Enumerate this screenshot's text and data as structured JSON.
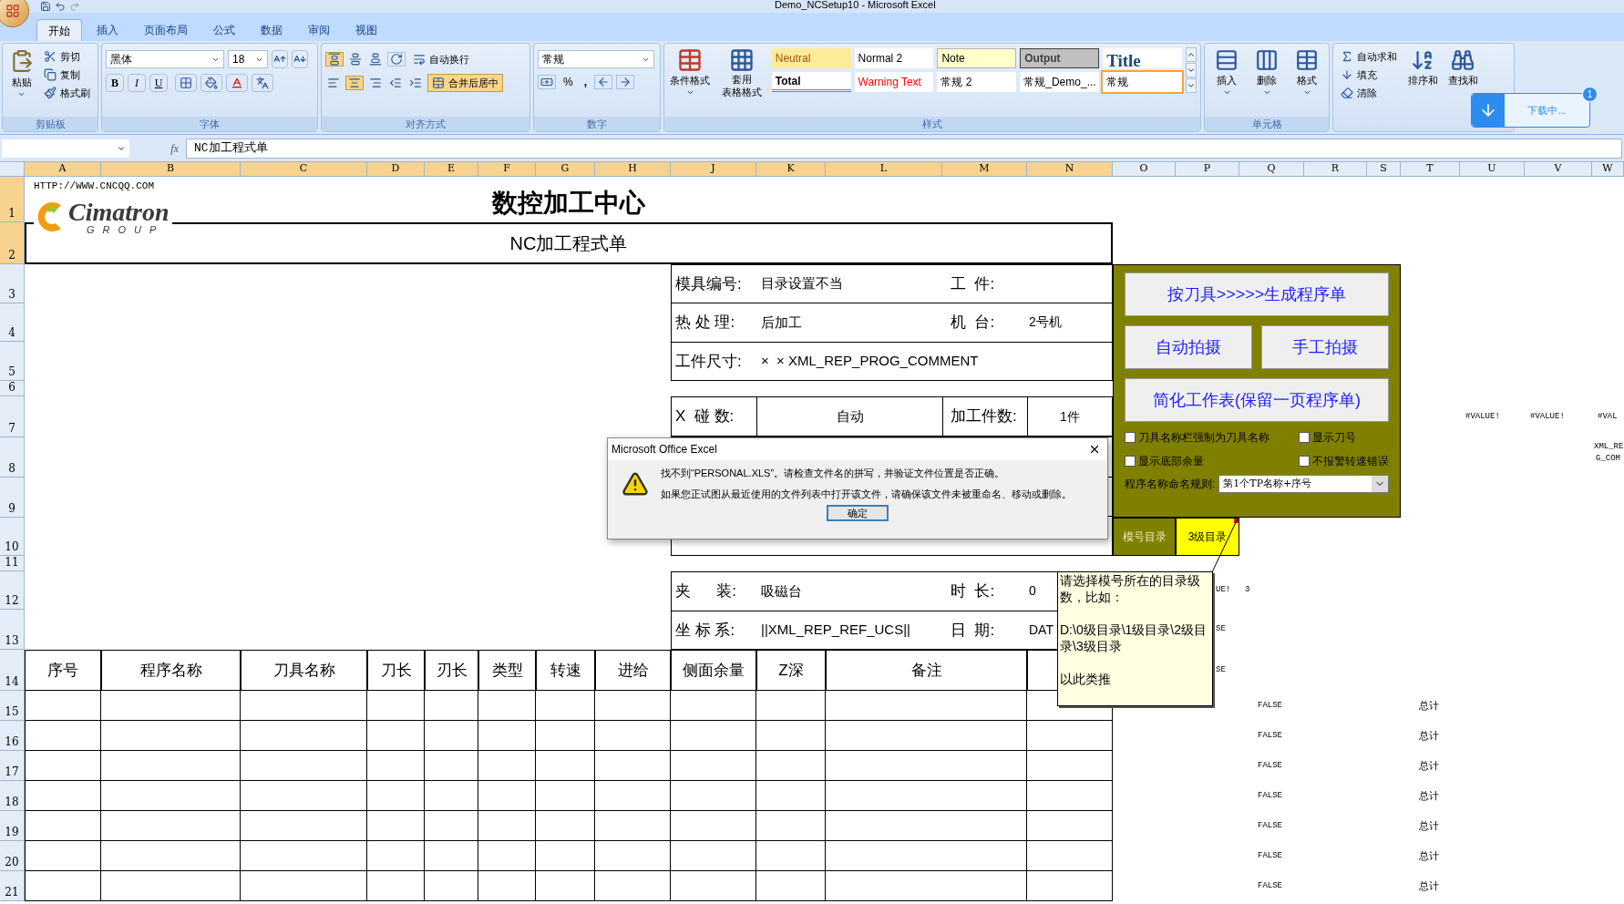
{
  "window": {
    "title": "Demo_NCSetup10 - Microsoft Excel"
  },
  "tabs": [
    {
      "label": "开始",
      "selected": true
    },
    {
      "label": "插入",
      "selected": false
    },
    {
      "label": "页面布局",
      "selected": false
    },
    {
      "label": "公式",
      "selected": false
    },
    {
      "label": "数据",
      "selected": false
    },
    {
      "label": "审阅",
      "selected": false
    },
    {
      "label": "视图",
      "selected": false
    }
  ],
  "ribbon": {
    "clipboard": {
      "label": "剪贴板",
      "paste": "粘贴",
      "items": [
        "剪切",
        "复制",
        "格式刷"
      ]
    },
    "font": {
      "label": "字体",
      "font_name": "黑体",
      "font_size": "18",
      "format_buttons": [
        "B",
        "I",
        "U"
      ]
    },
    "alignment": {
      "label": "对齐方式",
      "wrap": "自动换行",
      "merge": "合并后居中",
      "merge_on": true
    },
    "number": {
      "label": "数字",
      "format": "常规",
      "percent": "%",
      "comma": ","
    },
    "styles": {
      "label": "样式",
      "conditional": "条件格式",
      "table_format": [
        "套用",
        "表格格式"
      ],
      "gallery": [
        {
          "text": "Neutral",
          "kind": "neutral",
          "selected": false
        },
        {
          "text": "Normal 2",
          "kind": "plain",
          "selected": false
        },
        {
          "text": "Note",
          "kind": "note",
          "selected": false
        },
        {
          "text": "Output",
          "kind": "output",
          "selected": false
        },
        {
          "text": "Title",
          "kind": "title",
          "selected": false
        },
        {
          "text": "Total",
          "kind": "total",
          "selected": false
        },
        {
          "text": "Warning Text",
          "kind": "warning",
          "selected": false
        },
        {
          "text": "常规 2",
          "kind": "plain",
          "selected": false
        },
        {
          "text": "常规_Demo_...",
          "kind": "plain",
          "selected": false
        },
        {
          "text": "常规",
          "kind": "plain",
          "selected": true
        }
      ]
    },
    "cells": {
      "label": "单元格",
      "items": [
        "插入",
        "删除",
        "格式"
      ]
    },
    "editing": {
      "items": [
        "自动求和",
        "填充",
        "清除"
      ],
      "large": [
        "排序和",
        "查找和"
      ]
    }
  },
  "download": {
    "label": "下载中...",
    "count": "1"
  },
  "formula_bar": {
    "fx": "fx",
    "formula": "NC加工程式单"
  },
  "sheet": {
    "columns": [
      {
        "label": "A",
        "selected": true
      },
      {
        "label": "B",
        "selected": true
      },
      {
        "label": "C",
        "selected": true
      },
      {
        "label": "D",
        "selected": true
      },
      {
        "label": "E",
        "selected": true
      },
      {
        "label": "F",
        "selected": true
      },
      {
        "label": "G",
        "selected": true
      },
      {
        "label": "H",
        "selected": true
      },
      {
        "label": "J",
        "selected": true
      },
      {
        "label": "K",
        "selected": true
      },
      {
        "label": "L",
        "selected": true
      },
      {
        "label": "M",
        "selected": true
      },
      {
        "label": "N",
        "selected": true
      },
      {
        "label": "O",
        "selected": false
      },
      {
        "label": "P",
        "selected": false
      },
      {
        "label": "Q",
        "selected": false
      },
      {
        "label": "R",
        "selected": false
      },
      {
        "label": "S",
        "selected": false
      },
      {
        "label": "T",
        "selected": false
      },
      {
        "label": "U",
        "selected": false
      },
      {
        "label": "V",
        "selected": false
      },
      {
        "label": "W",
        "selected": false
      }
    ],
    "rows": [
      {
        "label": "1",
        "selected": true
      },
      {
        "label": "2",
        "selected": true
      },
      {
        "label": "3",
        "selected": false
      },
      {
        "label": "4",
        "selected": false
      },
      {
        "label": "5",
        "selected": false
      },
      {
        "label": "6",
        "selected": false
      },
      {
        "label": "7",
        "selected": false
      },
      {
        "label": "8",
        "selected": false
      },
      {
        "label": "9",
        "selected": false
      },
      {
        "label": "10",
        "selected": false
      },
      {
        "label": "11",
        "selected": false
      },
      {
        "label": "12",
        "selected": false
      },
      {
        "label": "13",
        "selected": false
      },
      {
        "label": "14",
        "selected": false
      },
      {
        "label": "15",
        "selected": false
      },
      {
        "label": "16",
        "selected": false
      },
      {
        "label": "17",
        "selected": false
      },
      {
        "label": "18",
        "selected": false
      },
      {
        "label": "19",
        "selected": false
      },
      {
        "label": "20",
        "selected": false
      },
      {
        "label": "21",
        "selected": false
      }
    ],
    "url": "HTTP://WWW.CNCQQ.COM",
    "logo": {
      "name": "Cimatron",
      "tagline": "GROUP"
    },
    "title": "数控加工中心",
    "subtitle": "NC加工程式单",
    "info_top": [
      {
        "label": "模具编号:",
        "value": "目录设置不当",
        "label2": "工  件:"
      },
      {
        "label": "热 处 理:",
        "value": "后加工",
        "label2": "机  台:",
        "value2": "2号机"
      },
      {
        "label": "工件尺寸:",
        "value": "×  × XML_REP_PROG_COMMENT"
      }
    ],
    "info_mid": {
      "label": "X  碰 数:",
      "value": "自动",
      "label2": "加工件数:",
      "value2": "1件"
    },
    "info_bottom": [
      {
        "label": "夹      装:",
        "value": "吸磁台",
        "label2": "时  长:",
        "value2": "0"
      },
      {
        "label": "坐 标 系:",
        "value": "||XML_REP_REF_UCS||",
        "label2": "日  期:",
        "value2": "DAT"
      }
    ],
    "table_headers": [
      "序号",
      "程序名称",
      "刀具名称",
      "刀长",
      "刃长",
      "类型",
      "转速",
      "进给",
      "侧面余量",
      "Z深",
      "备注"
    ],
    "dir_cells": [
      "模号目录",
      "3级目录"
    ],
    "side_values": [
      "#VALUE!",
      "#VALUE!",
      "#VAL",
      "XML_RE",
      "G_COM",
      "UE!",
      "3",
      "SE",
      "SE"
    ],
    "status_rows": [
      {
        "flag": "FALSE",
        "total": "总计"
      },
      {
        "flag": "FALSE",
        "total": "总计"
      },
      {
        "flag": "FALSE",
        "total": "总计"
      },
      {
        "flag": "FALSE",
        "total": "总计"
      },
      {
        "flag": "FALSE",
        "total": "总计"
      },
      {
        "flag": "FALSE",
        "total": "总计"
      },
      {
        "flag": "FALSE",
        "total": "总计"
      }
    ]
  },
  "panel": {
    "buttons": [
      "按刀具>>>>>生成程序单",
      "自动拍摄",
      "手工拍摄",
      "简化工作表(保留一页程序单)"
    ],
    "checkboxes": [
      {
        "label": "刀具名称栏强制为刀具名称",
        "checked": false
      },
      {
        "label": "显示刀号",
        "checked": false
      },
      {
        "label": "显示底部余量",
        "checked": false
      },
      {
        "label": "不报警转速错误",
        "checked": false
      }
    ],
    "rule_label": "程序名称命名规则:",
    "rule_value": "第1个TP名称+序号"
  },
  "comment": {
    "lines": [
      "请选择模号所在的目录级数，比如：",
      "D:\\0级目录\\1级目录\\2级目录\\3级目录",
      "以此类推"
    ]
  },
  "dialog": {
    "title": "Microsoft Office Excel",
    "lines": [
      "找不到“PERSONAL.XLS”。请检查文件名的拼写，并验证文件位置是否正确。",
      "如果您正试图从最近使用的文件列表中打开该文件，请确保该文件未被重命名、移动或删除。"
    ],
    "ok": "确定"
  }
}
